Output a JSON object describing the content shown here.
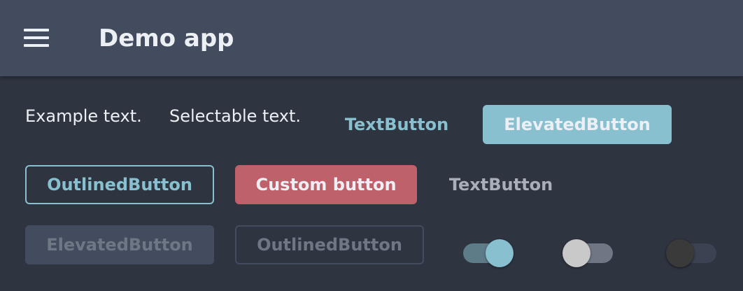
{
  "appbar": {
    "title": "Demo app",
    "menu_icon": "menu-icon"
  },
  "content": {
    "example_text": "Example text.",
    "selectable_text": "Selectable text.",
    "row1": {
      "text_button": "TextButton",
      "elevated_button": "ElevatedButton"
    },
    "row2": {
      "outlined_button": "OutlinedButton",
      "custom_button": "Custom button",
      "text_button": "TextButton"
    },
    "row3": {
      "elevated_button_disabled": "ElevatedButton",
      "outlined_button_disabled": "OutlinedButton"
    },
    "switches": [
      {
        "state": "on",
        "enabled": true
      },
      {
        "state": "off",
        "enabled": true
      },
      {
        "state": "off",
        "enabled": false
      }
    ]
  },
  "colors": {
    "background": "#2e3440",
    "appbar": "#434c5e",
    "primary": "#88c0d0",
    "custom": "#bf616a",
    "text": "#eceff4"
  }
}
